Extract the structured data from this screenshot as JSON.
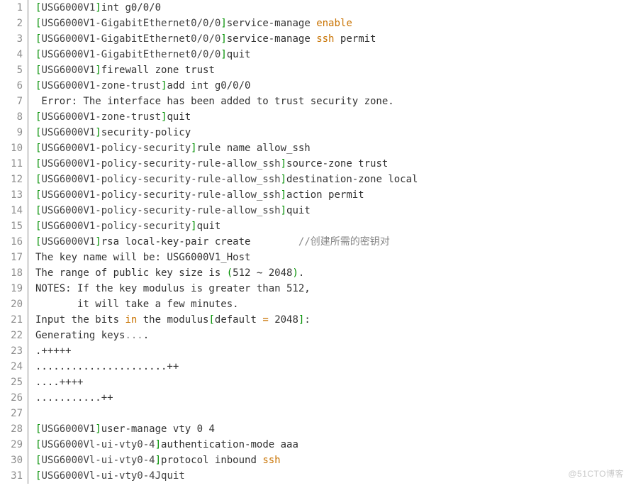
{
  "watermark": "@51CTO博客",
  "lines": [
    {
      "n": 1,
      "tokens": [
        {
          "c": "tok-punct",
          "t": "["
        },
        {
          "c": "tok-device",
          "t": "USG6000V1"
        },
        {
          "c": "tok-punct",
          "t": "]"
        },
        {
          "c": "tok-default",
          "t": "int g0/0/0"
        }
      ]
    },
    {
      "n": 2,
      "tokens": [
        {
          "c": "tok-punct",
          "t": "["
        },
        {
          "c": "tok-device",
          "t": "USG6000V1-GigabitEthernet0/0/0"
        },
        {
          "c": "tok-punct",
          "t": "]"
        },
        {
          "c": "tok-default",
          "t": "service-manage "
        },
        {
          "c": "tok-kw",
          "t": "enable"
        }
      ]
    },
    {
      "n": 3,
      "tokens": [
        {
          "c": "tok-punct",
          "t": "["
        },
        {
          "c": "tok-device",
          "t": "USG6000V1-GigabitEthernet0/0/0"
        },
        {
          "c": "tok-punct",
          "t": "]"
        },
        {
          "c": "tok-default",
          "t": "service-manage "
        },
        {
          "c": "tok-kw",
          "t": "ssh"
        },
        {
          "c": "tok-default",
          "t": " permit"
        }
      ]
    },
    {
      "n": 4,
      "tokens": [
        {
          "c": "tok-punct",
          "t": "["
        },
        {
          "c": "tok-device",
          "t": "USG6000V1-GigabitEthernet0/0/0"
        },
        {
          "c": "tok-punct",
          "t": "]"
        },
        {
          "c": "tok-default",
          "t": "quit"
        }
      ]
    },
    {
      "n": 5,
      "tokens": [
        {
          "c": "tok-punct",
          "t": "["
        },
        {
          "c": "tok-device",
          "t": "USG6000V1"
        },
        {
          "c": "tok-punct",
          "t": "]"
        },
        {
          "c": "tok-default",
          "t": "firewall zone trust"
        }
      ]
    },
    {
      "n": 6,
      "tokens": [
        {
          "c": "tok-punct",
          "t": "["
        },
        {
          "c": "tok-device",
          "t": "USG6000V1-zone-trust"
        },
        {
          "c": "tok-punct",
          "t": "]"
        },
        {
          "c": "tok-default",
          "t": "add int g0/0/0"
        }
      ]
    },
    {
      "n": 7,
      "tokens": [
        {
          "c": "tok-default",
          "t": " Error: The interface has been added to trust security zone."
        }
      ]
    },
    {
      "n": 8,
      "tokens": [
        {
          "c": "tok-punct",
          "t": "["
        },
        {
          "c": "tok-device",
          "t": "USG6000V1-zone-trust"
        },
        {
          "c": "tok-punct",
          "t": "]"
        },
        {
          "c": "tok-default",
          "t": "quit"
        }
      ]
    },
    {
      "n": 9,
      "tokens": [
        {
          "c": "tok-punct",
          "t": "["
        },
        {
          "c": "tok-device",
          "t": "USG6000V1"
        },
        {
          "c": "tok-punct",
          "t": "]"
        },
        {
          "c": "tok-default",
          "t": "security-policy"
        }
      ]
    },
    {
      "n": 10,
      "tokens": [
        {
          "c": "tok-punct",
          "t": "["
        },
        {
          "c": "tok-device",
          "t": "USG6000V1-policy-security"
        },
        {
          "c": "tok-punct",
          "t": "]"
        },
        {
          "c": "tok-default",
          "t": "rule name allow_ssh"
        }
      ]
    },
    {
      "n": 11,
      "tokens": [
        {
          "c": "tok-punct",
          "t": "["
        },
        {
          "c": "tok-device",
          "t": "USG6000V1-policy-security-rule-allow_ssh"
        },
        {
          "c": "tok-punct",
          "t": "]"
        },
        {
          "c": "tok-default",
          "t": "source-zone trust"
        }
      ]
    },
    {
      "n": 12,
      "tokens": [
        {
          "c": "tok-punct",
          "t": "["
        },
        {
          "c": "tok-device",
          "t": "USG6000V1-policy-security-rule-allow_ssh"
        },
        {
          "c": "tok-punct",
          "t": "]"
        },
        {
          "c": "tok-default",
          "t": "destination-zone local"
        }
      ]
    },
    {
      "n": 13,
      "tokens": [
        {
          "c": "tok-punct",
          "t": "["
        },
        {
          "c": "tok-device",
          "t": "USG6000V1-policy-security-rule-allow_ssh"
        },
        {
          "c": "tok-punct",
          "t": "]"
        },
        {
          "c": "tok-default",
          "t": "action permit"
        }
      ]
    },
    {
      "n": 14,
      "tokens": [
        {
          "c": "tok-punct",
          "t": "["
        },
        {
          "c": "tok-device",
          "t": "USG6000V1-policy-security-rule-allow_ssh"
        },
        {
          "c": "tok-punct",
          "t": "]"
        },
        {
          "c": "tok-default",
          "t": "quit"
        }
      ]
    },
    {
      "n": 15,
      "tokens": [
        {
          "c": "tok-punct",
          "t": "["
        },
        {
          "c": "tok-device",
          "t": "USG6000V1-policy-security"
        },
        {
          "c": "tok-punct",
          "t": "]"
        },
        {
          "c": "tok-default",
          "t": "quit"
        }
      ]
    },
    {
      "n": 16,
      "tokens": [
        {
          "c": "tok-punct",
          "t": "["
        },
        {
          "c": "tok-device",
          "t": "USG6000V1"
        },
        {
          "c": "tok-punct",
          "t": "]"
        },
        {
          "c": "tok-default",
          "t": "rsa local-key-pair create        "
        },
        {
          "c": "tok-comment",
          "t": "//创建所需的密钥对"
        }
      ]
    },
    {
      "n": 17,
      "tokens": [
        {
          "c": "tok-default",
          "t": "The key name will be: USG6000V1_Host"
        }
      ]
    },
    {
      "n": 18,
      "tokens": [
        {
          "c": "tok-default",
          "t": "The range of public key size is "
        },
        {
          "c": "tok-punct",
          "t": "("
        },
        {
          "c": "tok-default",
          "t": "512 ~ 2048"
        },
        {
          "c": "tok-punct",
          "t": ")"
        },
        {
          "c": "tok-default",
          "t": "."
        }
      ]
    },
    {
      "n": 19,
      "tokens": [
        {
          "c": "tok-default",
          "t": "NOTES: If the key modulus is greater than 512,"
        }
      ]
    },
    {
      "n": 20,
      "tokens": [
        {
          "c": "tok-default",
          "t": "       it will take a few minutes."
        }
      ]
    },
    {
      "n": 21,
      "tokens": [
        {
          "c": "tok-default",
          "t": "Input the bits "
        },
        {
          "c": "tok-kw",
          "t": "in"
        },
        {
          "c": "tok-default",
          "t": " the modulus"
        },
        {
          "c": "tok-punct",
          "t": "["
        },
        {
          "c": "tok-default",
          "t": "default "
        },
        {
          "c": "tok-kw",
          "t": "="
        },
        {
          "c": "tok-default",
          "t": " 2048"
        },
        {
          "c": "tok-punct",
          "t": "]"
        },
        {
          "c": "tok-default",
          "t": ":"
        }
      ]
    },
    {
      "n": 22,
      "tokens": [
        {
          "c": "tok-default",
          "t": "Generating keys"
        },
        {
          "c": "tok-comment",
          "t": "..."
        },
        {
          "c": "tok-default",
          "t": "."
        }
      ]
    },
    {
      "n": 23,
      "tokens": [
        {
          "c": "tok-default",
          "t": ".+++++"
        }
      ]
    },
    {
      "n": 24,
      "tokens": [
        {
          "c": "tok-default",
          "t": "......................++"
        }
      ]
    },
    {
      "n": 25,
      "tokens": [
        {
          "c": "tok-default",
          "t": "....++++"
        }
      ]
    },
    {
      "n": 26,
      "tokens": [
        {
          "c": "tok-default",
          "t": "...........++"
        }
      ]
    },
    {
      "n": 27,
      "tokens": [
        {
          "c": "tok-default",
          "t": ""
        }
      ]
    },
    {
      "n": 28,
      "tokens": [
        {
          "c": "tok-punct",
          "t": "["
        },
        {
          "c": "tok-device",
          "t": "USG6000V1"
        },
        {
          "c": "tok-punct",
          "t": "]"
        },
        {
          "c": "tok-default",
          "t": "user-manage vty 0 4"
        }
      ]
    },
    {
      "n": 29,
      "tokens": [
        {
          "c": "tok-punct",
          "t": "["
        },
        {
          "c": "tok-device",
          "t": "USG6000Vl-ui-vty0-4"
        },
        {
          "c": "tok-punct",
          "t": "]"
        },
        {
          "c": "tok-default",
          "t": "authentication-mode aaa"
        }
      ]
    },
    {
      "n": 30,
      "tokens": [
        {
          "c": "tok-punct",
          "t": "["
        },
        {
          "c": "tok-device",
          "t": "USG6000Vl-ui-vty0-4"
        },
        {
          "c": "tok-punct",
          "t": "]"
        },
        {
          "c": "tok-default",
          "t": "protocol inbound "
        },
        {
          "c": "tok-kw",
          "t": "ssh"
        }
      ]
    },
    {
      "n": 31,
      "tokens": [
        {
          "c": "tok-punct",
          "t": "["
        },
        {
          "c": "tok-device",
          "t": "USG6000Vl-ui-vty0-4Jquit"
        }
      ]
    }
  ]
}
